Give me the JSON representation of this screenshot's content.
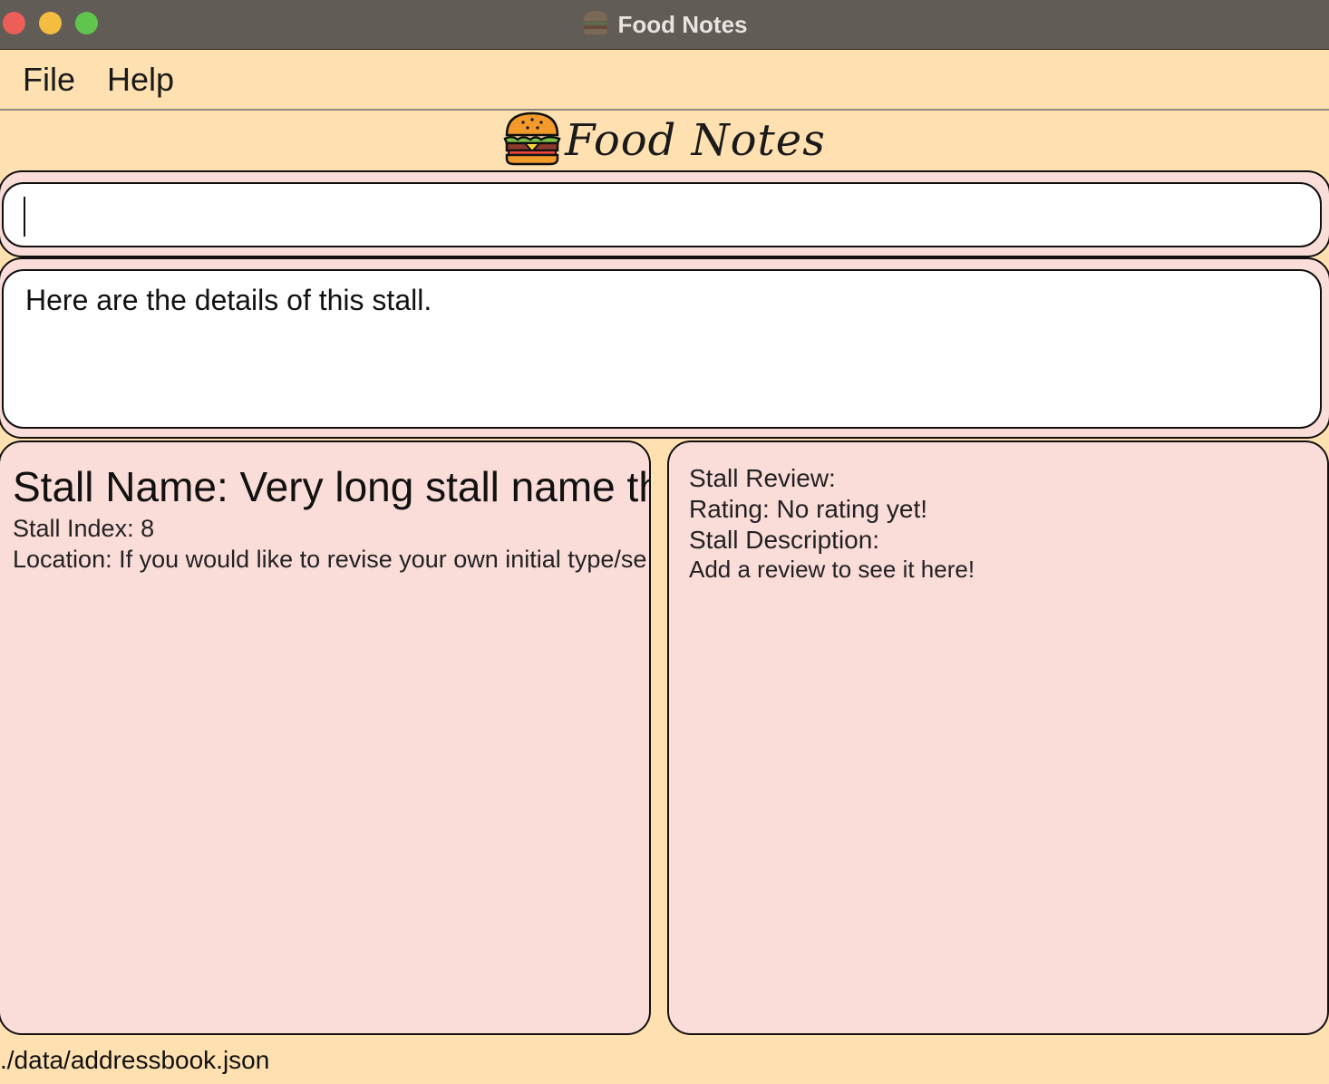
{
  "window": {
    "title": "Food Notes",
    "title_icon": "burger-icon"
  },
  "menu": {
    "items": [
      {
        "label": "File"
      },
      {
        "label": "Help"
      }
    ]
  },
  "logo": {
    "text": "Food Notes",
    "icon": "burger-icon"
  },
  "command_box": {
    "value": "",
    "placeholder": ""
  },
  "result_display": {
    "text": "Here are the details of this stall."
  },
  "stall_detail": {
    "name": "Stall Name: Very long stall name tha",
    "index": "Stall Index: 8",
    "location": "Location: If you would like to revise your own initial type/se"
  },
  "stall_review": {
    "heading": "Stall Review:",
    "rating": "Rating: No rating yet!",
    "description_label": "Stall Description:",
    "description": "Add a review to see it here!"
  },
  "status_bar": {
    "file_path": "./data/addressbook.json"
  },
  "colors": {
    "background": "#ffe0b0",
    "panel": "#fadcd8",
    "titlebar": "#625c57"
  }
}
